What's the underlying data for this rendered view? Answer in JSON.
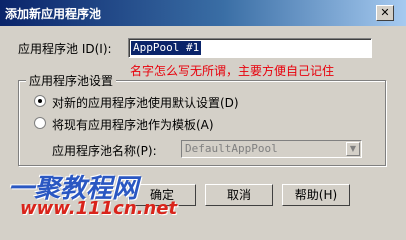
{
  "window": {
    "title": "添加新应用程序池",
    "close_glyph": "✕"
  },
  "id_field": {
    "label": "应用程序池 ID(I):",
    "value": "AppPool #1"
  },
  "note": "名字怎么写无所谓，主要方便自己记住",
  "group": {
    "label": "应用程序池设置",
    "options": [
      {
        "label": "对新的应用程序池使用默认设置(D)",
        "checked": true
      },
      {
        "label": "将现有应用程序池作为模板(A)",
        "checked": false
      }
    ],
    "template_label": "应用程序池名称(P):",
    "template_value": "DefaultAppPool"
  },
  "buttons": {
    "ok": "确定",
    "cancel": "取消",
    "help": "帮助(H)"
  },
  "watermark": {
    "brand": "一聚教程网",
    "url": "www.111cn.net"
  }
}
